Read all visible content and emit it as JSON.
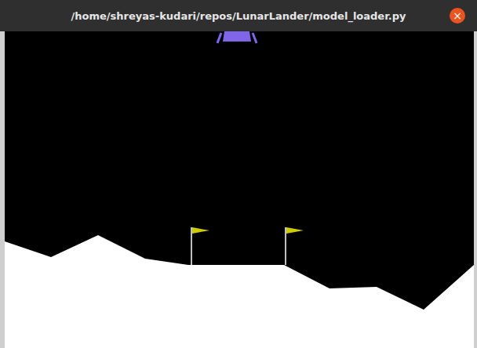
{
  "window": {
    "title": "/home/shreyas-kudari/repos/LunarLander/model_loader.py",
    "close_button": "×"
  }
}
